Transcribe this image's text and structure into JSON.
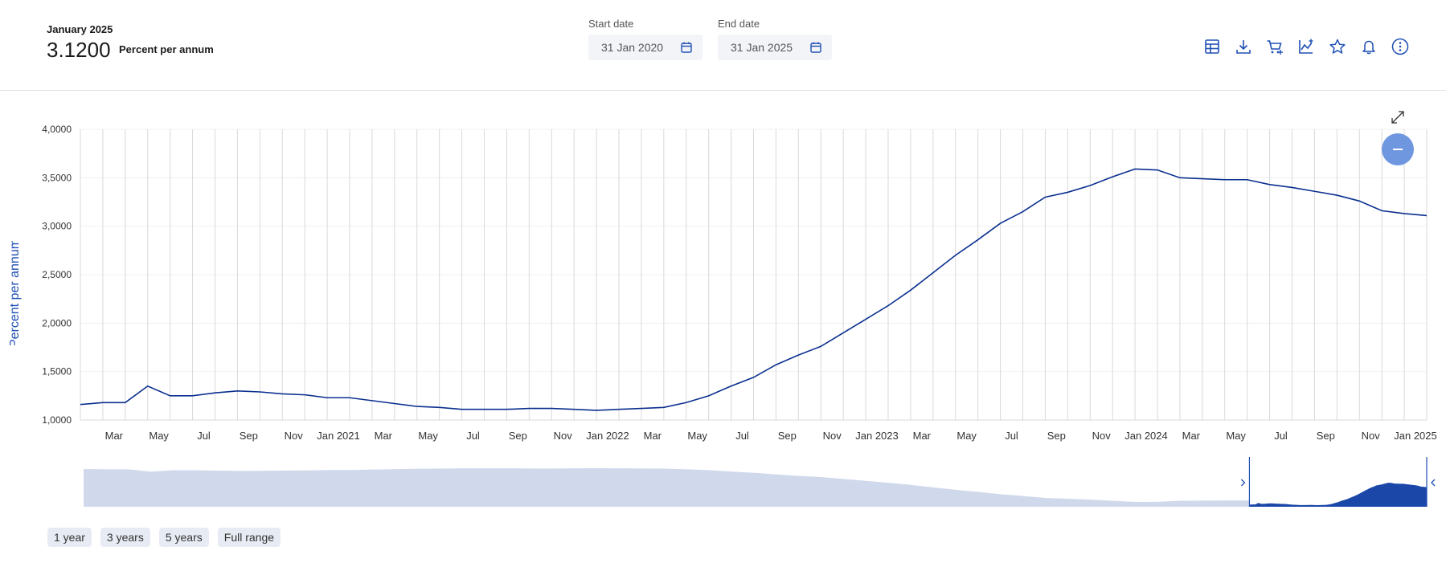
{
  "header": {
    "period": "January 2025",
    "value": "3.1200",
    "unit": "Percent per annum"
  },
  "dates": {
    "start_label": "Start date",
    "start_value": "31 Jan 2020",
    "end_label": "End date",
    "end_value": "31 Jan 2025"
  },
  "toolbar": {
    "icons": [
      "table-icon",
      "download-icon",
      "cart-add-icon",
      "chart-add-icon",
      "star-icon",
      "bell-icon",
      "more-vertical-icon"
    ]
  },
  "range_buttons": [
    "1 year",
    "3 years",
    "5 years",
    "Full range"
  ],
  "colors": {
    "line": "#0a2f8f",
    "navigator_fill": "#d0d9ec",
    "navigator_selected": "#1a47a8",
    "zoom_button": "#6f97e0",
    "accent": "#1f4fb4"
  },
  "chart_data": {
    "type": "line",
    "title": "",
    "xlabel": "",
    "ylabel": "Percent per annum",
    "ylim": [
      1.0,
      4.0
    ],
    "yticks": [
      "1,0000",
      "1,5000",
      "2,0000",
      "2,5000",
      "3,0000",
      "3,5000",
      "4,0000"
    ],
    "xtick_labels": [
      "Mar",
      "May",
      "Jul",
      "Sep",
      "Nov",
      "Jan 2021",
      "Mar",
      "May",
      "Jul",
      "Sep",
      "Nov",
      "Jan 2022",
      "Mar",
      "May",
      "Jul",
      "Sep",
      "Nov",
      "Jan 2023",
      "Mar",
      "May",
      "Jul",
      "Sep",
      "Nov",
      "Jan 2024",
      "Mar",
      "May",
      "Jul",
      "Sep",
      "Nov",
      "Jan 2025"
    ],
    "x_start": "2020-01",
    "x": [
      "2020-01",
      "2020-02",
      "2020-03",
      "2020-04",
      "2020-05",
      "2020-06",
      "2020-07",
      "2020-08",
      "2020-09",
      "2020-10",
      "2020-11",
      "2020-12",
      "2021-01",
      "2021-02",
      "2021-03",
      "2021-04",
      "2021-05",
      "2021-06",
      "2021-07",
      "2021-08",
      "2021-09",
      "2021-10",
      "2021-11",
      "2021-12",
      "2022-01",
      "2022-02",
      "2022-03",
      "2022-04",
      "2022-05",
      "2022-06",
      "2022-07",
      "2022-08",
      "2022-09",
      "2022-10",
      "2022-11",
      "2022-12",
      "2023-01",
      "2023-02",
      "2023-03",
      "2023-04",
      "2023-05",
      "2023-06",
      "2023-07",
      "2023-08",
      "2023-09",
      "2023-10",
      "2023-11",
      "2023-12",
      "2024-01",
      "2024-02",
      "2024-03",
      "2024-04",
      "2024-05",
      "2024-06",
      "2024-07",
      "2024-08",
      "2024-09",
      "2024-10",
      "2024-11",
      "2024-12",
      "2025-01"
    ],
    "series": [
      {
        "values": [
          1.16,
          1.18,
          1.18,
          1.35,
          1.25,
          1.25,
          1.28,
          1.3,
          1.29,
          1.27,
          1.26,
          1.23,
          1.23,
          1.2,
          1.17,
          1.14,
          1.13,
          1.11,
          1.11,
          1.11,
          1.12,
          1.12,
          1.11,
          1.1,
          1.11,
          1.12,
          1.13,
          1.18,
          1.25,
          1.35,
          1.44,
          1.57,
          1.67,
          1.76,
          1.9,
          2.04,
          2.18,
          2.34,
          2.52,
          2.7,
          2.86,
          3.03,
          3.15,
          3.3,
          3.35,
          3.42,
          3.51,
          3.59,
          3.58,
          3.5,
          3.49,
          3.48,
          3.48,
          3.43,
          3.4,
          3.36,
          3.32,
          3.26,
          3.16,
          3.13,
          3.11
        ]
      }
    ],
    "navigator": {
      "selected_range": [
        "2024-01",
        "2025-01"
      ]
    },
    "grid": true,
    "legend": "none"
  }
}
